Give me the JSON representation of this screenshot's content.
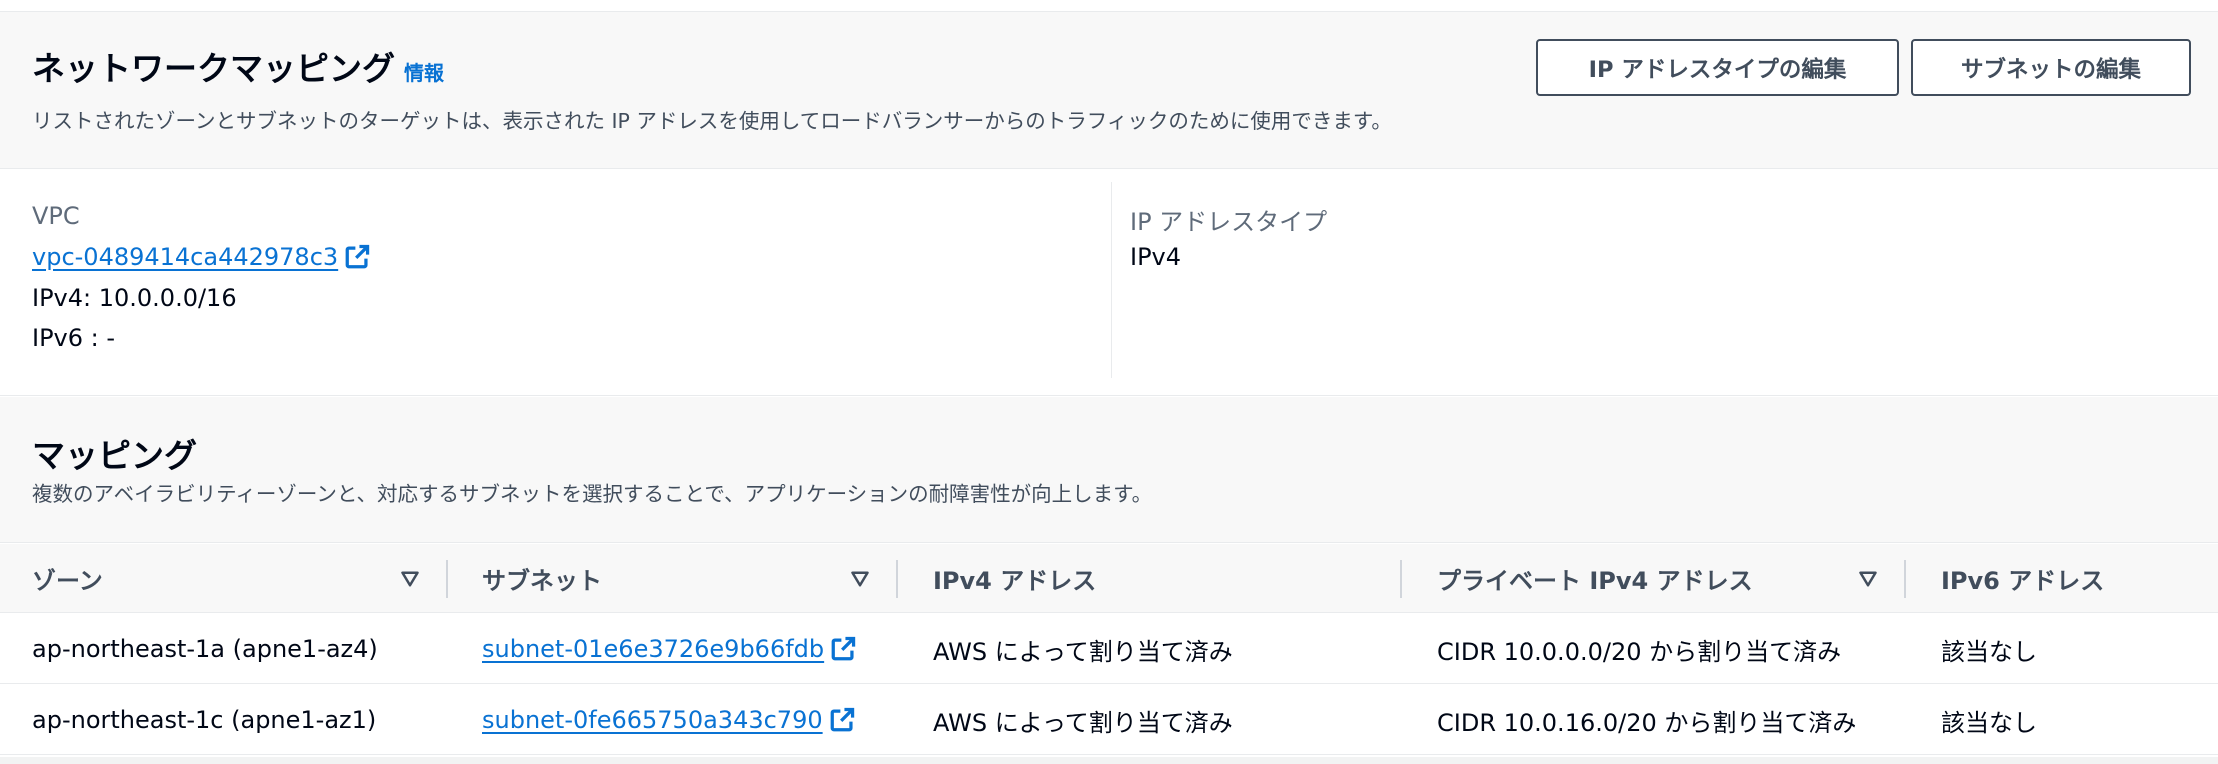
{
  "header": {
    "title": "ネットワークマッピング",
    "info_link": "情報",
    "description": "リストされたゾーンとサブネットのターゲットは、表示された IP アドレスを使用してロードバランサーからのトラフィックのために使用できます。",
    "buttons": {
      "edit_ip_type": "IP アドレスタイプの編集",
      "edit_subnets": "サブネットの編集"
    }
  },
  "vpc": {
    "label": "VPC",
    "id": "vpc-0489414ca442978c3",
    "ipv4": "IPv4: 10.0.0.0/16",
    "ipv6": "IPv6 : -",
    "ip_type_label": "IP アドレスタイプ",
    "ip_type_value": "IPv4"
  },
  "mapping": {
    "title": "マッピング",
    "description": "複数のアベイラビリティーゾーンと、対応するサブネットを選択することで、アプリケーションの耐障害性が向上します。",
    "columns": [
      "ゾーン",
      "サブネット",
      "IPv4 アドレス",
      "プライベート IPv4 アドレス",
      "IPv6 アドレス"
    ],
    "rows": [
      {
        "zone": "ap-northeast-1a (apne1-az4)",
        "subnet": "subnet-01e6e3726e9b66fdb",
        "ipv4": "AWS によって割り当て済み",
        "private_ipv4": "CIDR 10.0.0.0/20 から割り当て済み",
        "ipv6": "該当なし"
      },
      {
        "zone": "ap-northeast-1c (apne1-az1)",
        "subnet": "subnet-0fe665750a343c790",
        "ipv4": "AWS によって割り当て済み",
        "private_ipv4": "CIDR 10.0.16.0/20 から割り当て済み",
        "ipv6": "該当なし"
      }
    ]
  },
  "icons": {
    "external_link": "external-link-icon",
    "sort": "sort-caret-down-icon"
  },
  "colors": {
    "link": "#0972d3",
    "text": "#000716",
    "muted": "#5f6b7a",
    "panel_bg": "#f8f8f8"
  }
}
